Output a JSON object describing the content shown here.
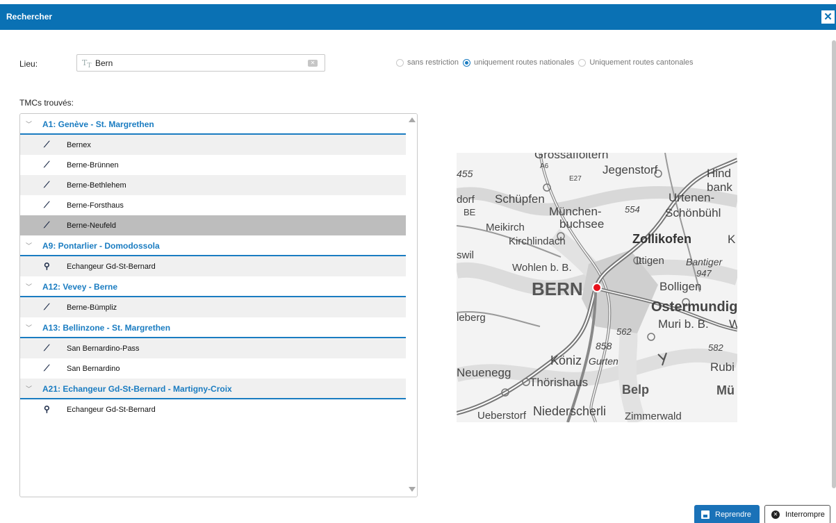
{
  "dialog": {
    "title": "Rechercher",
    "close_glyph": "✕"
  },
  "search": {
    "label": "Lieu:",
    "value": "Bern",
    "type_icon": "text-type-icon",
    "clear_icon": "clear-input-icon"
  },
  "filters": [
    {
      "label": "sans restriction",
      "selected": false
    },
    {
      "label": "uniquement routes nationales",
      "selected": true
    },
    {
      "label": "Uniquement routes cantonales",
      "selected": false
    }
  ],
  "results": {
    "label": "TMCs trouvés:",
    "groups": [
      {
        "title": "A1: Genève - St. Margrethen",
        "items": [
          {
            "label": "Bernex",
            "icon": "road-exit-icon"
          },
          {
            "label": "Berne-Brünnen",
            "icon": "road-exit-icon"
          },
          {
            "label": "Berne-Bethlehem",
            "icon": "road-exit-icon"
          },
          {
            "label": "Berne-Forsthaus",
            "icon": "road-exit-icon"
          },
          {
            "label": "Berne-Neufeld",
            "icon": "road-exit-icon",
            "selected": true
          }
        ]
      },
      {
        "title": "A9: Pontarlier - Domodossola",
        "items": [
          {
            "label": "Echangeur Gd-St-Bernard",
            "icon": "interchange-icon"
          }
        ]
      },
      {
        "title": "A12: Vevey - Berne",
        "items": [
          {
            "label": "Berne-Bümpliz",
            "icon": "road-exit-icon"
          }
        ]
      },
      {
        "title": "A13: Bellinzone - St. Margrethen",
        "items": [
          {
            "label": "San Bernardino-Pass",
            "icon": "road-exit-icon"
          },
          {
            "label": "San Bernardino",
            "icon": "road-exit-icon"
          }
        ]
      },
      {
        "title": "A21: Echangeur Gd-St-Bernard - Martigny-Croix",
        "items": [
          {
            "label": "Echangeur Gd-St-Bernard",
            "icon": "interchange-icon"
          }
        ]
      }
    ]
  },
  "map": {
    "labels": {
      "top": "Grossaffoltern",
      "jegenstorf": "Jegenstorf",
      "hind": "Hind",
      "bank": "bank",
      "n455": "455",
      "schupfen": "Schüpfen",
      "urtenen": "Urtenen-",
      "schonbuhl": "Schönbühl",
      "dorf": "dorf",
      "be": "BE",
      "munchen": "München-",
      "n554": "554",
      "buchsee": "buchsee",
      "meikirch": "Meikirch",
      "zollikofen": "Zollikofen",
      "kirchlindach": "Kirchlindach",
      "ittigen": "Ittigen",
      "bantiger": "Bantiger",
      "n947": "947",
      "swil": "swil",
      "wohlen": "Wohlen b. B.",
      "bolligen": "Bolligen",
      "bern": "BERN",
      "ostermundig": "Ostermundig",
      "leberg": "leberg",
      "n562": "562",
      "muri": "Muri b. B.",
      "n858": "858",
      "n582": "582",
      "koniz": "Köniz",
      "gurten": "Gurten",
      "rubi": "Rubi",
      "neuenegg": "Neuenegg",
      "thorishaus": "Thörishaus",
      "belp": "Belp",
      "mu": "Mü",
      "ueberstorf": "Ueberstorf",
      "niederscherli": "Niederscherli",
      "zimmerwald": "Zimmerwald",
      "a6": "A6",
      "e27": "E27",
      "k": "K",
      "w": "W"
    },
    "marker_color": "#e8111b"
  },
  "actions": {
    "primary": "Reprendre",
    "secondary": "Interrompre"
  },
  "colors": {
    "header": "#0a71b4",
    "accent": "#1a7cc1"
  }
}
